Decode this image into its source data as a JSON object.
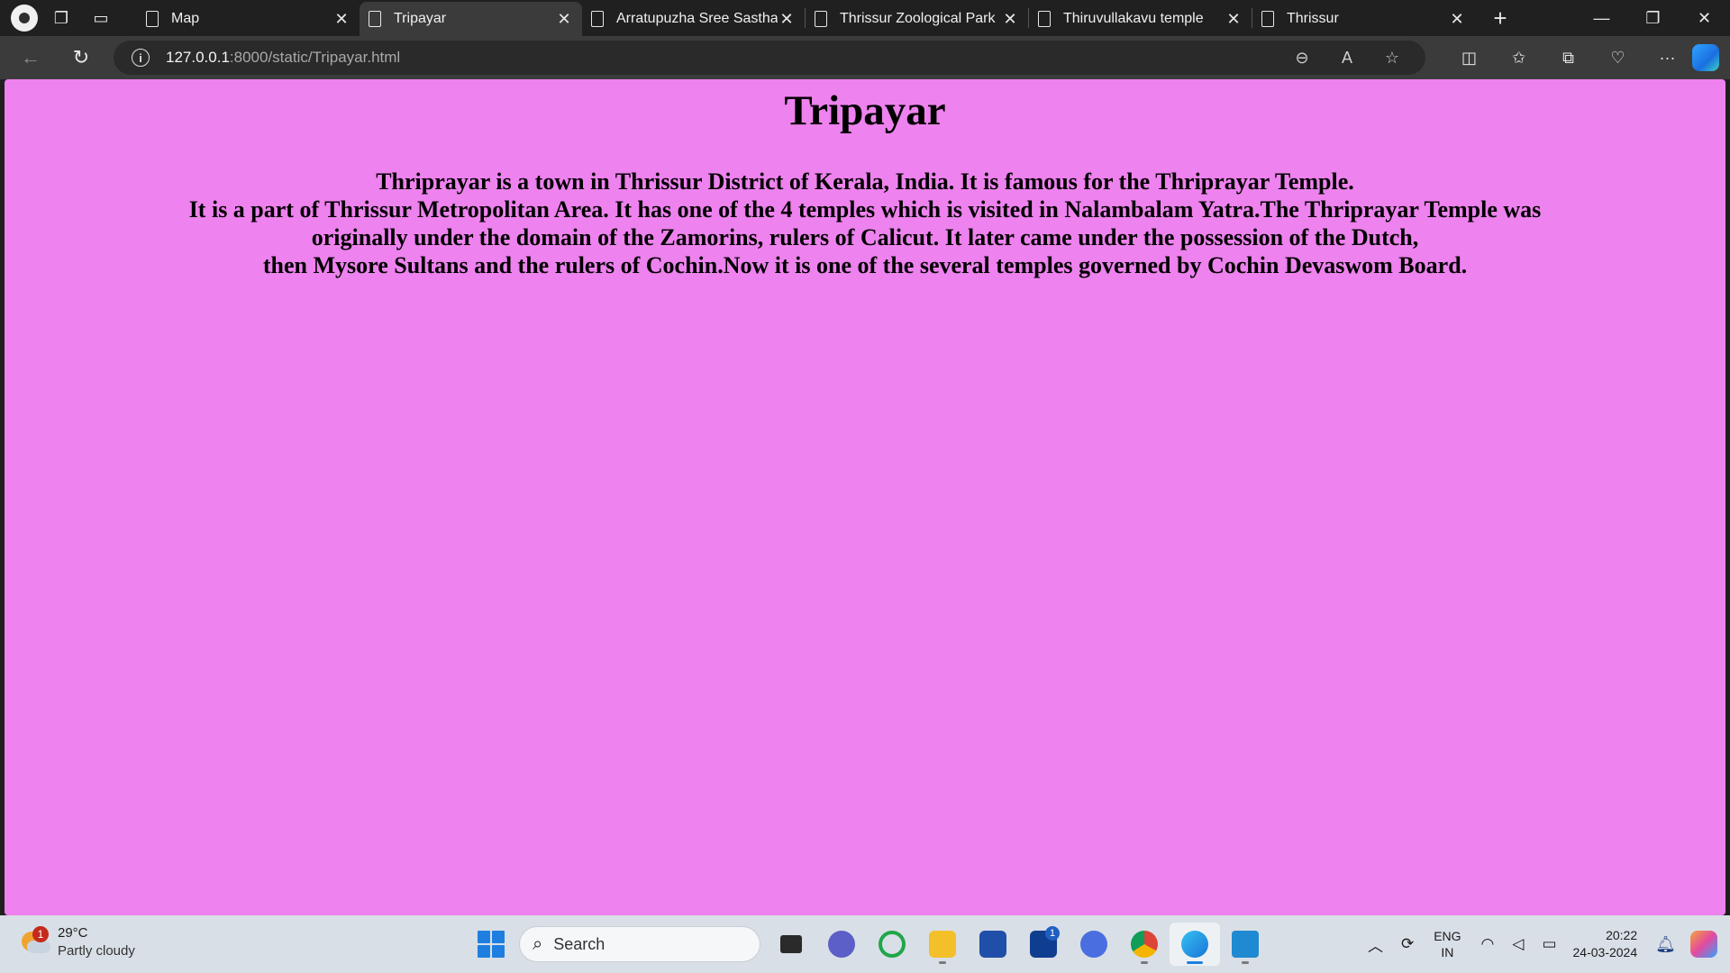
{
  "browser": {
    "tabs": [
      {
        "label": "Map",
        "active": false
      },
      {
        "label": "Tripayar",
        "active": true
      },
      {
        "label": "Arratupuzha Sree Sastha",
        "active": false
      },
      {
        "label": "Thrissur Zoological Park",
        "active": false
      },
      {
        "label": "Thiruvullakavu temple",
        "active": false
      },
      {
        "label": "Thrissur",
        "active": false
      }
    ],
    "url_host": "127.0.0.1",
    "url_rest": ":8000/static/Tripayar.html"
  },
  "page": {
    "title": "Tripayar",
    "lines": [
      "Thriprayar is a town in Thrissur District of Kerala, India. It is famous for the Thriprayar Temple.",
      "It is a part of Thrissur Metropolitan Area. It has one of the 4 temples which is visited in Nalambalam Yatra.The Thriprayar Temple was",
      "originally under the domain of the Zamorins, rulers of Calicut. It later came under the possession of the Dutch,",
      "then Mysore Sultans and the rulers of Cochin.Now it is one of the several temples governed by Cochin Devaswom Board."
    ],
    "background": "#ee82ee"
  },
  "taskbar": {
    "weather_badge": "1",
    "temperature": "29°C",
    "condition": "Partly cloudy",
    "search_label": "Search",
    "app_badge": "1",
    "lang_top": "ENG",
    "lang_bottom": "IN",
    "time": "20:22",
    "date": "24-03-2024"
  }
}
